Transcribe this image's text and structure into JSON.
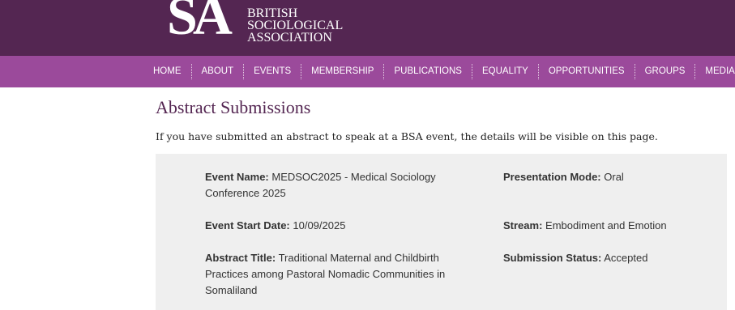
{
  "header": {
    "logo_mark": "SA",
    "logo_lines": [
      "BRITISH",
      "SOCIOLOGICAL",
      "ASSOCIATION"
    ]
  },
  "nav": {
    "items": [
      "HOME",
      "ABOUT",
      "EVENTS",
      "MEMBERSHIP",
      "PUBLICATIONS",
      "EQUALITY",
      "OPPORTUNITIES",
      "GROUPS",
      "MEDIA CENTRE"
    ]
  },
  "main": {
    "title": "Abstract Submissions",
    "intro": "If you have submitted an abstract to speak at a BSA event, the details will be visible on this page."
  },
  "submission": {
    "event_name_label": "Event Name:",
    "event_name": "MEDSOC2025 - Medical Sociology Conference 2025",
    "presentation_mode_label": "Presentation Mode:",
    "presentation_mode": "Oral",
    "event_start_date_label": "Event Start Date:",
    "event_start_date": "10/09/2025",
    "stream_label": "Stream:",
    "stream": "Embodiment and Emotion",
    "abstract_title_label": "Abstract Title:",
    "abstract_title": "Traditional Maternal and Childbirth Practices among Pastoral Nomadic Communities in Somaliland",
    "submission_status_label": "Submission Status:",
    "submission_status": "Accepted"
  },
  "colors": {
    "header_bg": "#542652",
    "nav_bg": "#9b4a9b",
    "panel_bg": "#efefef",
    "title_color": "#542652"
  }
}
